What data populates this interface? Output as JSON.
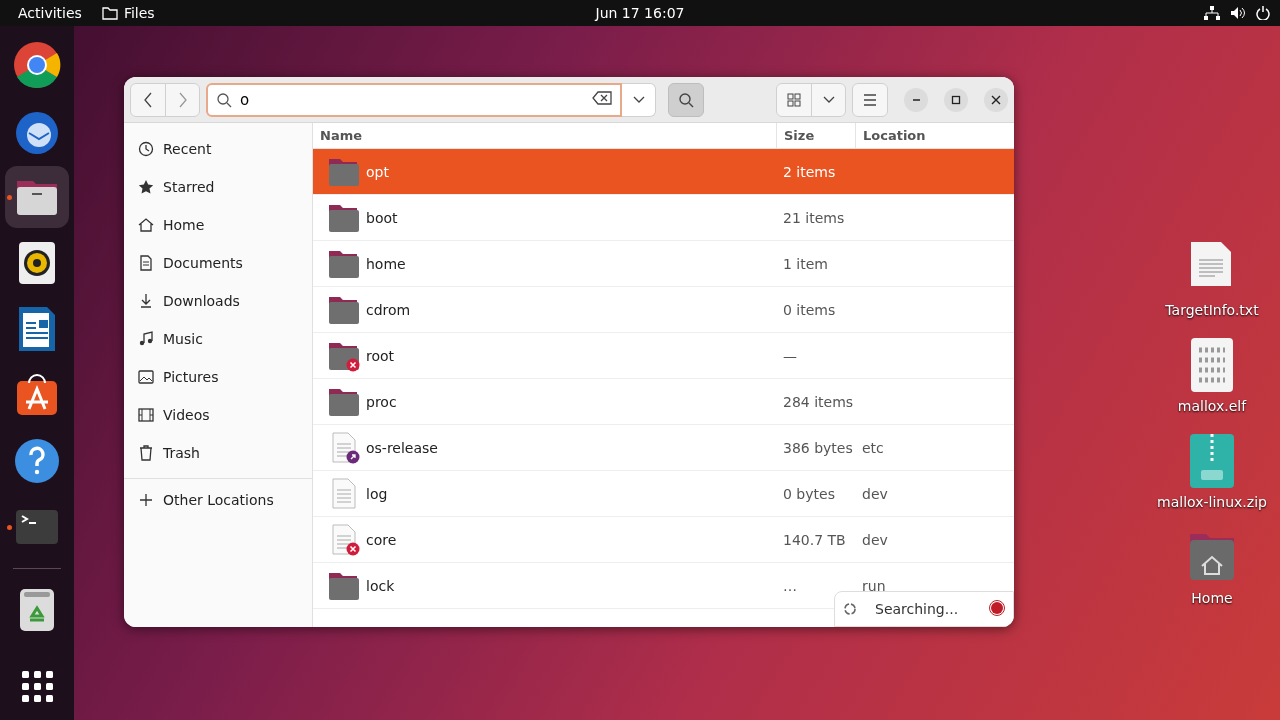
{
  "top_bar": {
    "activities": "Activities",
    "app": "Files",
    "clock": "Jun 17  16:07"
  },
  "dock": [
    {
      "kind": "chrome",
      "running": false,
      "selected": false
    },
    {
      "kind": "mail",
      "running": false,
      "selected": false
    },
    {
      "kind": "files",
      "running": true,
      "selected": true
    },
    {
      "kind": "audio",
      "running": false,
      "selected": false
    },
    {
      "kind": "writer",
      "running": false,
      "selected": false
    },
    {
      "kind": "store",
      "running": false,
      "selected": false
    },
    {
      "kind": "help",
      "running": false,
      "selected": false
    },
    {
      "kind": "terminal",
      "running": true,
      "selected": false
    },
    {
      "kind": "trash",
      "running": false,
      "selected": false
    }
  ],
  "window": {
    "search": {
      "value": "o"
    },
    "sidebar": [
      {
        "label": "Recent"
      },
      {
        "label": "Starred"
      },
      {
        "label": "Home"
      },
      {
        "label": "Documents"
      },
      {
        "label": "Downloads"
      },
      {
        "label": "Music"
      },
      {
        "label": "Pictures"
      },
      {
        "label": "Videos"
      },
      {
        "label": "Trash"
      }
    ],
    "other_locations": "Other Locations",
    "columns": [
      "Name",
      "Size",
      "Location"
    ],
    "rows": [
      {
        "kind": "folder",
        "name": "opt",
        "size": "2 items",
        "selected": true
      },
      {
        "kind": "folder",
        "name": "boot",
        "size": "21 items",
        "selected": false
      },
      {
        "kind": "folder",
        "name": "home",
        "size": "1 item",
        "selected": false
      },
      {
        "kind": "folder",
        "name": "cdrom",
        "size": "0 items",
        "selected": false
      },
      {
        "kind": "lockedfolder",
        "name": "root",
        "size": "—",
        "selected": false
      },
      {
        "kind": "folder",
        "name": "proc",
        "size": "284 items",
        "selected": false
      },
      {
        "kind": "link",
        "name": "os-release",
        "size": "386 bytes",
        "location": "etc",
        "selected": false
      },
      {
        "kind": "file",
        "name": "log",
        "size": "0 bytes",
        "location": "dev",
        "selected": false
      },
      {
        "kind": "brokenfile",
        "name": "core",
        "size": "140.7 TB",
        "location": "dev",
        "selected": false
      },
      {
        "kind": "folder",
        "name": "lock",
        "size": "…",
        "location": "run",
        "selected": false
      }
    ],
    "status": "Searching..."
  },
  "desktop": [
    {
      "kind": "text",
      "label": "TargetInfo.txt"
    },
    {
      "kind": "binary",
      "label": "mallox.elf"
    },
    {
      "kind": "zip",
      "label": "mallox-linux.zip"
    },
    {
      "kind": "home",
      "label": "Home"
    }
  ]
}
